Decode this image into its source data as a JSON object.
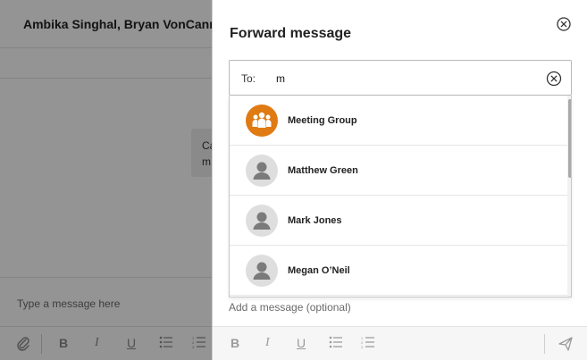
{
  "conversation": {
    "title": "Ambika Singhal, Bryan VonCannn, Je",
    "bubble_line1": "Ca",
    "bubble_line2": "m",
    "compose_placeholder": "Type a message here",
    "toolbar": {
      "attach_icon": "paperclip-icon",
      "bold": "B",
      "italic": "I",
      "underline": "U",
      "bullets_icon": "bullet-list-icon",
      "numbered_icon": "numbered-list-icon"
    }
  },
  "forward_panel": {
    "title": "Forward message",
    "close_icon": "close-circle-icon",
    "to_label": "To:",
    "to_value": "m",
    "clear_icon": "clear-circle-icon",
    "suggestions": [
      {
        "name": "Meeting Group",
        "avatar": "group-icon"
      },
      {
        "name": "Matthew Green",
        "avatar": "person-icon"
      },
      {
        "name": "Mark Jones",
        "avatar": "person-icon"
      },
      {
        "name": "Megan O’Neil",
        "avatar": "person-icon"
      }
    ],
    "message_placeholder": "Add a message (optional)",
    "toolbar": {
      "bold": "B",
      "italic": "I",
      "underline": "U",
      "bullets_icon": "bullet-list-icon",
      "numbered_icon": "numbered-list-icon",
      "send_icon": "send-icon"
    }
  },
  "colors": {
    "group_avatar": "#e07a12",
    "person_avatar": "#dedede",
    "overlay": "rgba(0,0,0,0.42)"
  }
}
